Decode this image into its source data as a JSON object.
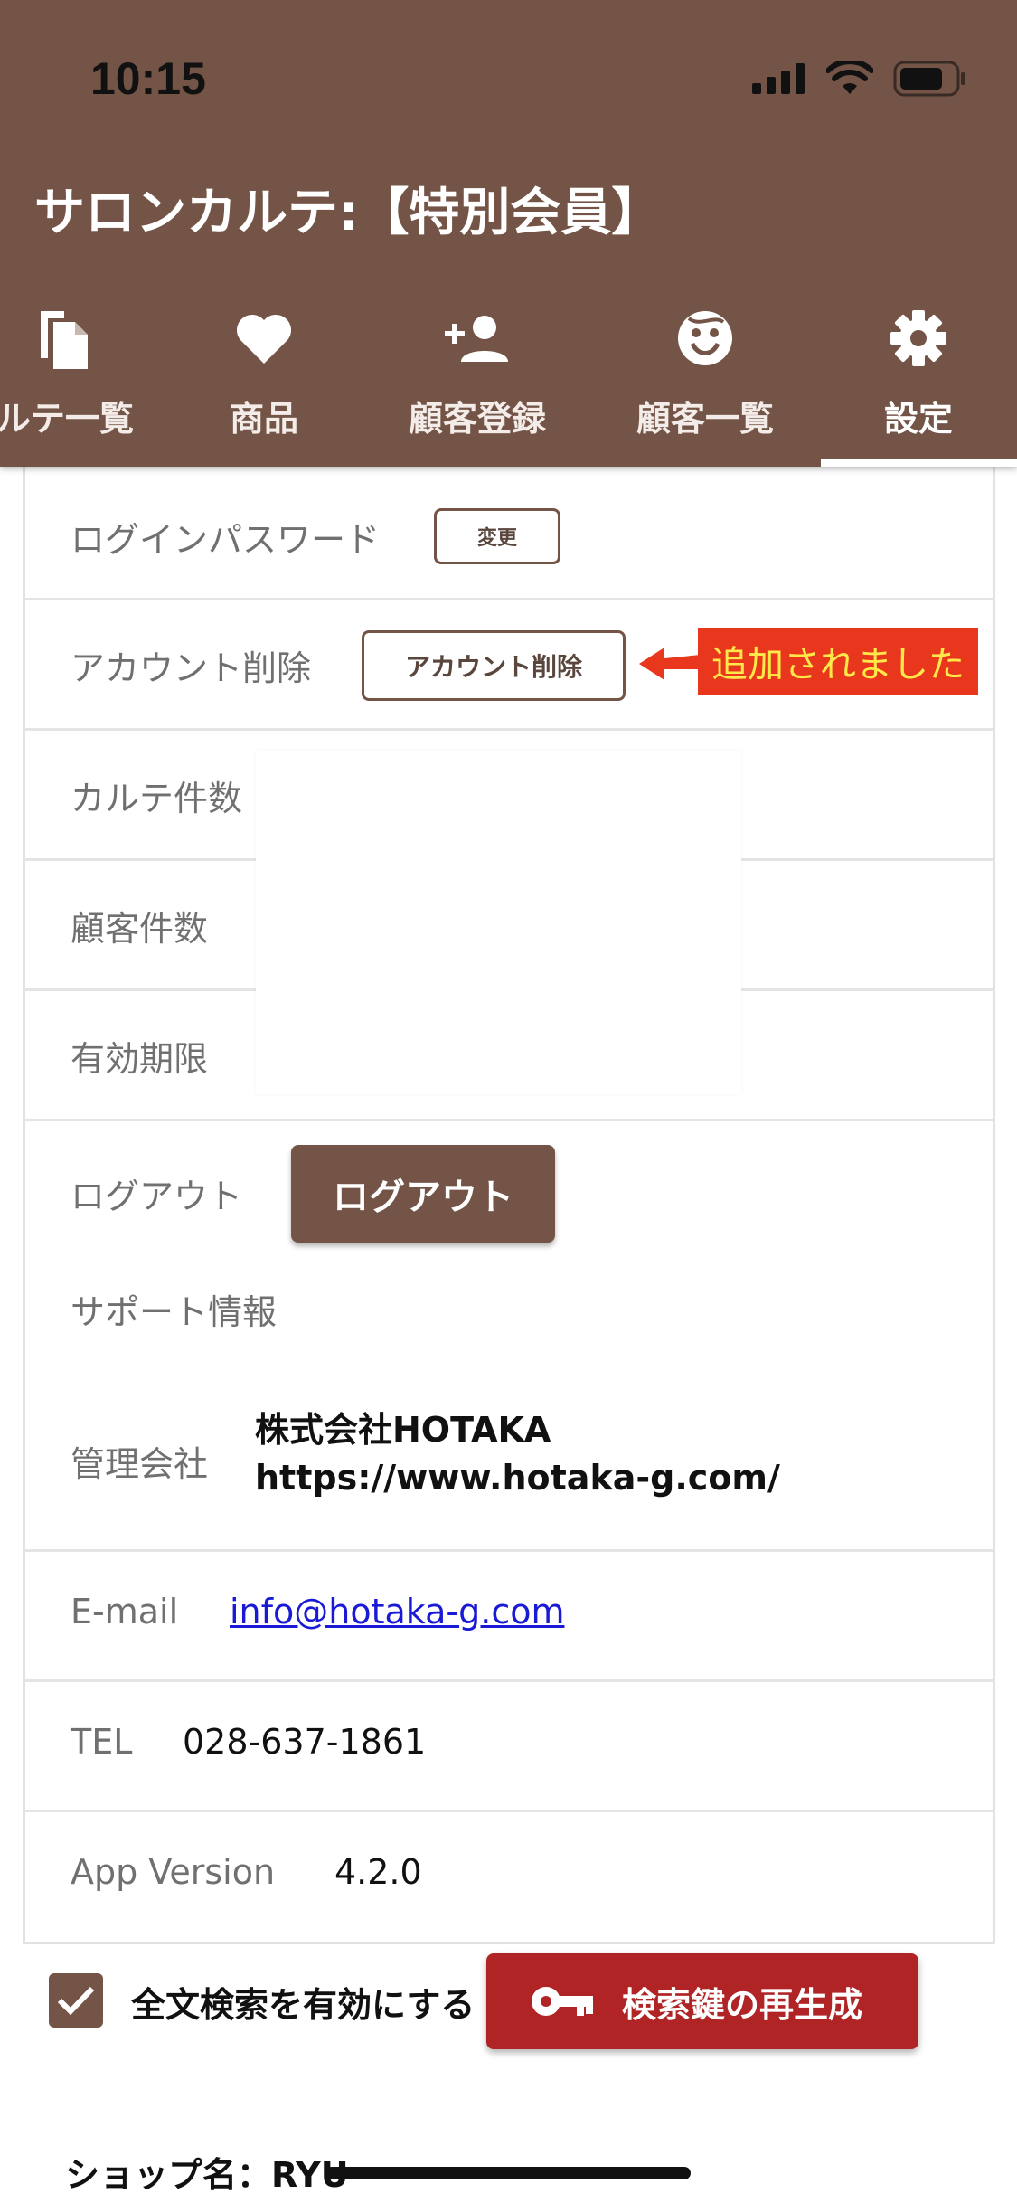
{
  "status_bar": {
    "time": "10:15"
  },
  "app": {
    "title": "サロンカルテ:【特別会員】"
  },
  "tabs": [
    {
      "label": "ルテ一覧",
      "icon": "copy-file-icon"
    },
    {
      "label": "商品",
      "icon": "heart-icon"
    },
    {
      "label": "顧客登録",
      "icon": "add-person-icon"
    },
    {
      "label": "顧客一覧",
      "icon": "face-icon"
    },
    {
      "label": "設定",
      "icon": "gear-icon",
      "active": true
    }
  ],
  "settings": {
    "password": {
      "label": "ログインパスワード",
      "button": "変更"
    },
    "delete_account": {
      "label": "アカウント削除",
      "button": "アカウント削除"
    },
    "karte_count": {
      "label": "カルテ件数"
    },
    "customer_count": {
      "label": "顧客件数"
    },
    "expiry": {
      "label": "有効期限"
    },
    "logout": {
      "label": "ログアウト",
      "button": "ログアウト"
    },
    "support": {
      "heading": "サポート情報"
    },
    "company": {
      "label": "管理会社",
      "name": "株式会社HOTAKA",
      "url": "https://www.hotaka-g.com/"
    },
    "email": {
      "label": "E-mail",
      "value": "info@hotaka-g.com"
    },
    "tel": {
      "label": "TEL",
      "value": "028-637-1861"
    },
    "version": {
      "label": "App Version",
      "value": "4.2.0"
    }
  },
  "annotation": {
    "text": "追加されました",
    "color": "#e8371d"
  },
  "bottom": {
    "fulltext_search_label": "全文検索を有効にする",
    "fulltext_search_checked": true,
    "regen_button": "検索鍵の再生成",
    "shop_name": "ショップ名：RYU"
  },
  "colors": {
    "brand": "#735447",
    "danger": "#b02425",
    "link": "#1a1ad6"
  }
}
